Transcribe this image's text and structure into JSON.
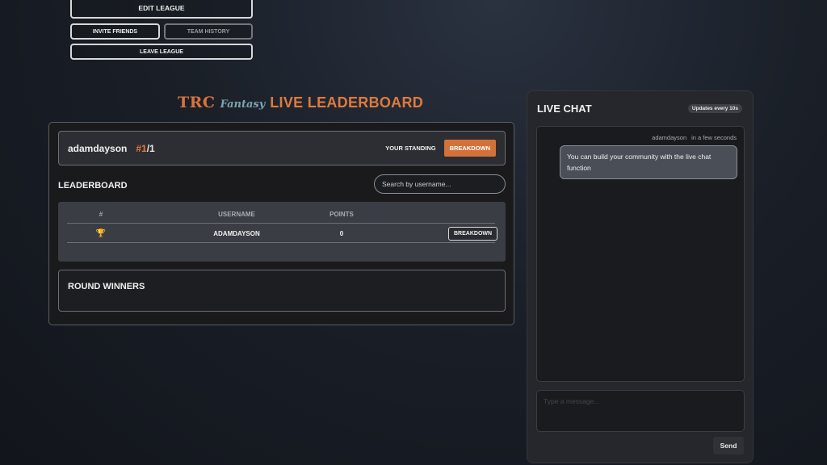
{
  "league_actions": {
    "edit_label": "EDIT LEAGUE",
    "invite_label": "INVITE FRIENDS",
    "history_label": "TEAM HISTORY",
    "leave_label": "LEAVE LEAGUE"
  },
  "hero": {
    "brand": "TRC",
    "brand_script": "Fantasy",
    "title": "LIVE LEADERBOARD"
  },
  "standing": {
    "username": "adamdayson",
    "rank_prefix": "#1",
    "rank_suffix": "/1",
    "label": "YOUR STANDING",
    "breakdown_label": "BREAKDOWN"
  },
  "leaderboard": {
    "title": "LEADERBOARD",
    "search_placeholder": "Search by username...",
    "columns": [
      "#",
      "USERNAME",
      "POINTS"
    ],
    "rows": [
      {
        "rank_icon": "trophy-icon",
        "rank_glyph": "🏆",
        "username": "ADAMDAYSON",
        "points": "0",
        "breakdown_label": "BREAKDOWN"
      }
    ]
  },
  "round_winners": {
    "title": "ROUND WINNERS"
  },
  "chat": {
    "title": "LIVE CHAT",
    "badge": "Updates every 10s",
    "messages": [
      {
        "author": "adamdayson",
        "time": "in a few seconds",
        "text": "You can build your community with the live chat function"
      }
    ],
    "composer_placeholder": "Type a message...",
    "send_label": "Send"
  },
  "colors": {
    "accent": "#d4713a",
    "panel": "#1a1a1c",
    "chat_bg": "#25272c"
  }
}
